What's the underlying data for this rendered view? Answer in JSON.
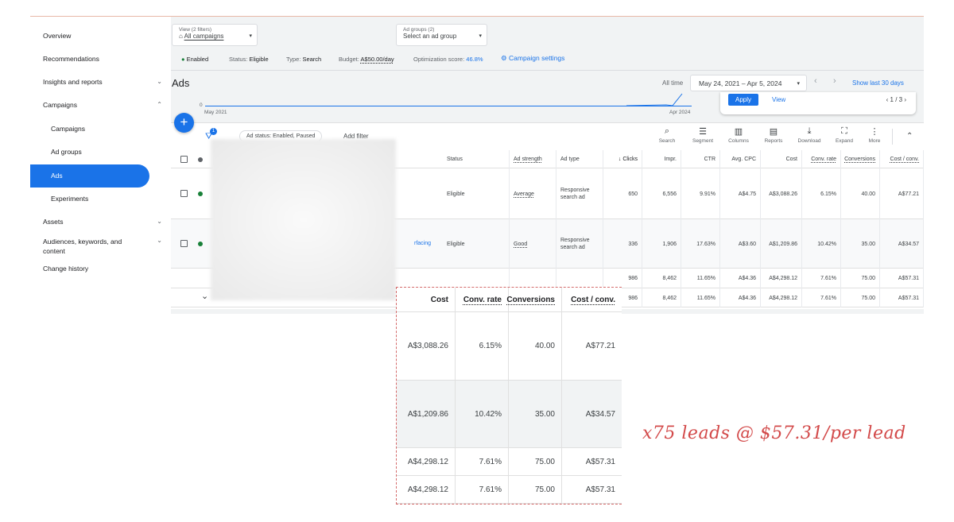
{
  "sidebar": {
    "items": [
      {
        "label": "Overview"
      },
      {
        "label": "Recommendations"
      },
      {
        "label": "Insights and reports",
        "chev": "⌄"
      },
      {
        "label": "Campaigns",
        "chev": "⌃"
      },
      {
        "label": "Campaigns",
        "sub": true
      },
      {
        "label": "Ad groups",
        "sub": true
      },
      {
        "label": "Ads",
        "active": true
      },
      {
        "label": "Experiments",
        "sub": true
      },
      {
        "label": "Assets",
        "chev": "⌄"
      },
      {
        "label": "Audiences, keywords, and content",
        "chev": "⌄"
      },
      {
        "label": "Change history"
      }
    ]
  },
  "header": {
    "view_label": "View (2 filters)",
    "view_value": "All campaigns",
    "adgroups_label": "Ad groups (2)",
    "adgroups_value": "Select an ad group"
  },
  "meta": {
    "enabled": "Enabled",
    "status_label": "Status:",
    "status": "Eligible",
    "type_label": "Type:",
    "type": "Search",
    "budget_label": "Budget:",
    "budget": "A$50.00/day",
    "opt_label": "Optimization score:",
    "opt": "46.8%",
    "settings": "Campaign settings"
  },
  "page_title": "Ads",
  "date": {
    "all_time": "All time",
    "range": "May 24, 2021 – Apr 5, 2024",
    "show_last": "Show last 30 days"
  },
  "chart": {
    "y0": "0",
    "start": "May 2021",
    "end": "Apr 2024"
  },
  "popup": {
    "apply": "Apply",
    "view": "View",
    "pager": "1 / 3"
  },
  "filter": {
    "badge": "1",
    "chip": "Ad status: Enabled, Paused",
    "add": "Add filter"
  },
  "toolbar": [
    {
      "icon": "⌕",
      "label": "Search",
      "name": "search"
    },
    {
      "icon": "☰",
      "label": "Segment",
      "name": "segment"
    },
    {
      "icon": "▥",
      "label": "Columns",
      "name": "columns"
    },
    {
      "icon": "▤",
      "label": "Reports",
      "name": "reports"
    },
    {
      "icon": "⤓",
      "label": "Download",
      "name": "download"
    },
    {
      "icon": "⛶",
      "label": "Expand",
      "name": "expand"
    },
    {
      "icon": "⋮",
      "label": "More",
      "name": "more"
    }
  ],
  "table": {
    "headers": [
      "Status",
      "Ad strength",
      "Ad type",
      "↓ Clicks",
      "Impr.",
      "CTR",
      "Avg. CPC",
      "Cost",
      "Conv. rate",
      "Conversions",
      "Cost / conv."
    ],
    "rows": [
      [
        "Eligible",
        "Average",
        "Responsive search ad",
        "650",
        "6,556",
        "9.91%",
        "A$4.75",
        "A$3,088.26",
        "6.15%",
        "40.00",
        "A$77.21"
      ],
      [
        "Eligible",
        "Good",
        "Responsive search ad",
        "336",
        "1,906",
        "17.63%",
        "A$3.60",
        "A$1,209.86",
        "10.42%",
        "35.00",
        "A$34.57"
      ],
      [
        "",
        "",
        "",
        "986",
        "8,462",
        "11.65%",
        "A$4.36",
        "A$4,298.12",
        "7.61%",
        "75.00",
        "A$57.31"
      ],
      [
        "",
        "",
        "",
        "986",
        "8,462",
        "11.65%",
        "A$4.36",
        "A$4,298.12",
        "7.61%",
        "75.00",
        "A$57.31"
      ]
    ],
    "partial_link": "rfacing"
  },
  "callout": {
    "headers": [
      "Cost",
      "Conv. rate",
      "Conversions",
      "Cost / conv."
    ],
    "rows": [
      [
        "A$3,088.26",
        "6.15%",
        "40.00",
        "A$77.21"
      ],
      [
        "A$1,209.86",
        "10.42%",
        "35.00",
        "A$34.57"
      ],
      [
        "A$4,298.12",
        "7.61%",
        "75.00",
        "A$57.31"
      ],
      [
        "A$4,298.12",
        "7.61%",
        "75.00",
        "A$57.31"
      ]
    ]
  },
  "annotation": "x75 leads @ $57.31/per lead",
  "colors": {
    "accent": "#1a73e8",
    "green": "#188038",
    "note": "#d34a4a"
  }
}
